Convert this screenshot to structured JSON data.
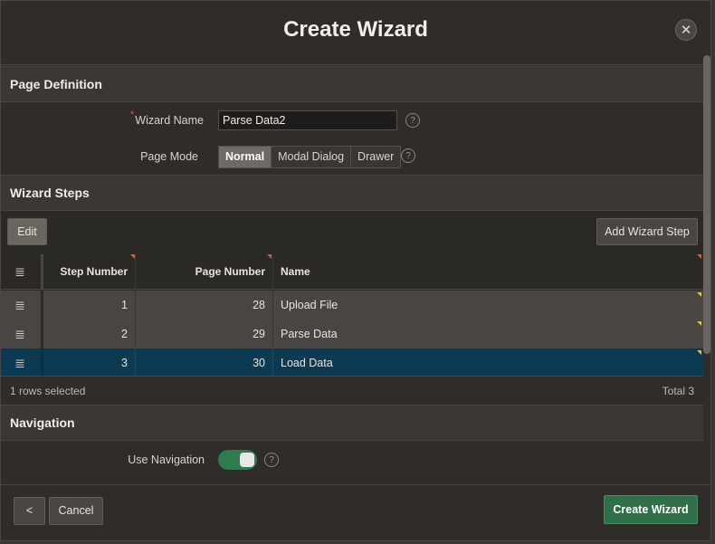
{
  "dialog": {
    "title": "Create Wizard",
    "close_icon": "close-icon"
  },
  "page_definition": {
    "header": "Page Definition",
    "wizard_name_label": "Wizard Name",
    "wizard_name_value": "Parse Data2",
    "page_mode_label": "Page Mode",
    "page_mode_options": [
      "Normal",
      "Modal Dialog",
      "Drawer"
    ],
    "page_mode_selected": "Normal",
    "help_glyph": "?"
  },
  "wizard_steps": {
    "header": "Wizard Steps",
    "edit_label": "Edit",
    "add_step_label": "Add Wizard Step",
    "columns": [
      "Step Number",
      "Page Number",
      "Name"
    ],
    "rows": [
      {
        "step": "1",
        "page": "28",
        "name": "Upload File"
      },
      {
        "step": "2",
        "page": "29",
        "name": "Parse Data"
      },
      {
        "step": "3",
        "page": "30",
        "name": "Load Data"
      }
    ],
    "selected_row": 3,
    "rows_selected_text": "1 rows selected",
    "total_text": "Total 3"
  },
  "navigation": {
    "header": "Navigation",
    "use_navigation_label": "Use Navigation",
    "use_navigation_on": true
  },
  "footer": {
    "back_glyph": "<",
    "cancel_label": "Cancel",
    "create_label": "Create Wizard"
  },
  "colors": {
    "accent_green": "#2f6f4a",
    "selected_row": "#0b3a52",
    "required": "#e05a3a"
  }
}
